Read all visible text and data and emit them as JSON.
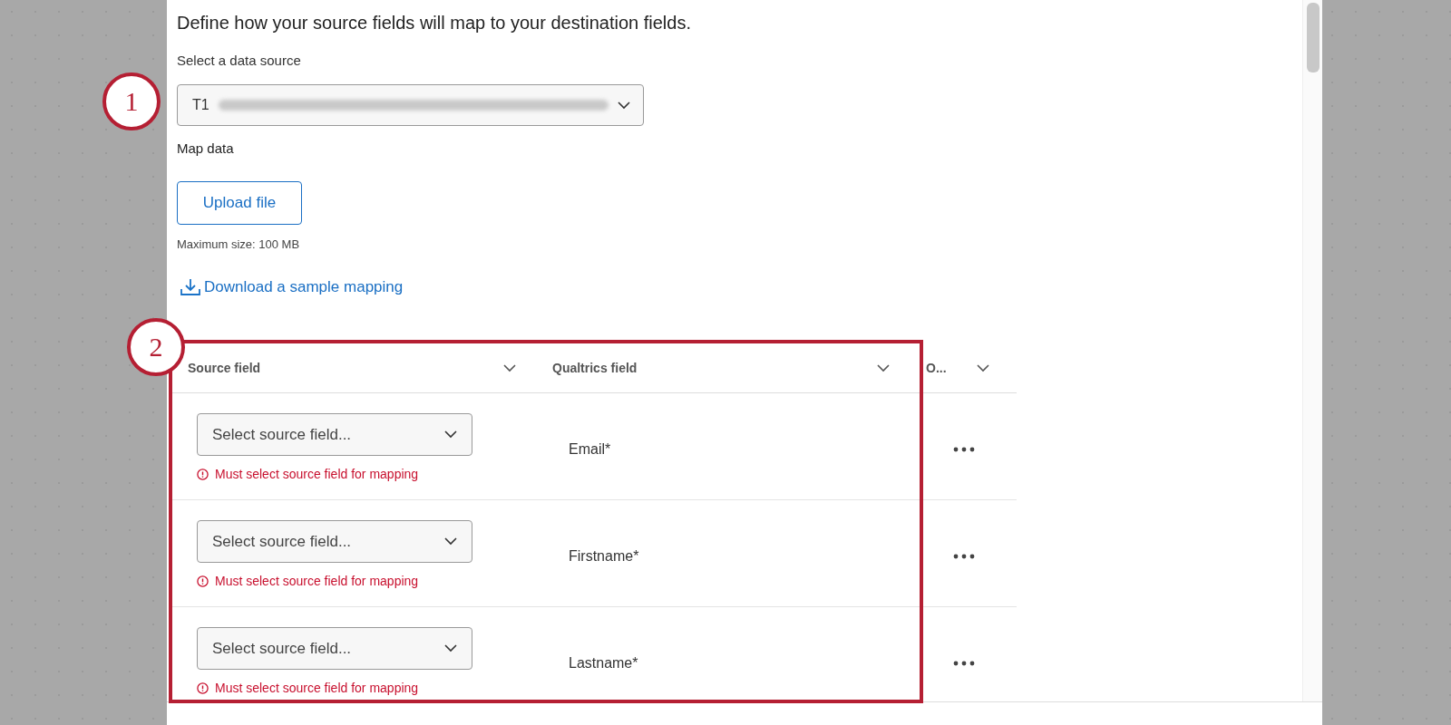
{
  "heading": "Define how your source fields will map to your destination fields.",
  "data_source": {
    "label": "Select a data source",
    "value": "T1"
  },
  "map_data": {
    "label": "Map data",
    "upload_button": "Upload file",
    "max_size": "Maximum size: 100 MB",
    "download_link": "Download a sample mapping"
  },
  "table": {
    "columns": [
      {
        "label": "Source field"
      },
      {
        "label": "Qualtrics field"
      },
      {
        "label": "O..."
      }
    ],
    "rows": [
      {
        "placeholder": "Select source field...",
        "error": true,
        "error_text": "Must select source field for mapping",
        "qualtrics_field": "Email*"
      },
      {
        "placeholder": "Select source field...",
        "error": true,
        "error_text": "Must select source field for mapping",
        "qualtrics_field": "Firstname*"
      },
      {
        "placeholder": "Select source field...",
        "error": true,
        "error_text": "Must select source field for mapping",
        "qualtrics_field": "Lastname*"
      }
    ]
  },
  "annotations": [
    {
      "label": "1"
    },
    {
      "label": "2"
    }
  ]
}
